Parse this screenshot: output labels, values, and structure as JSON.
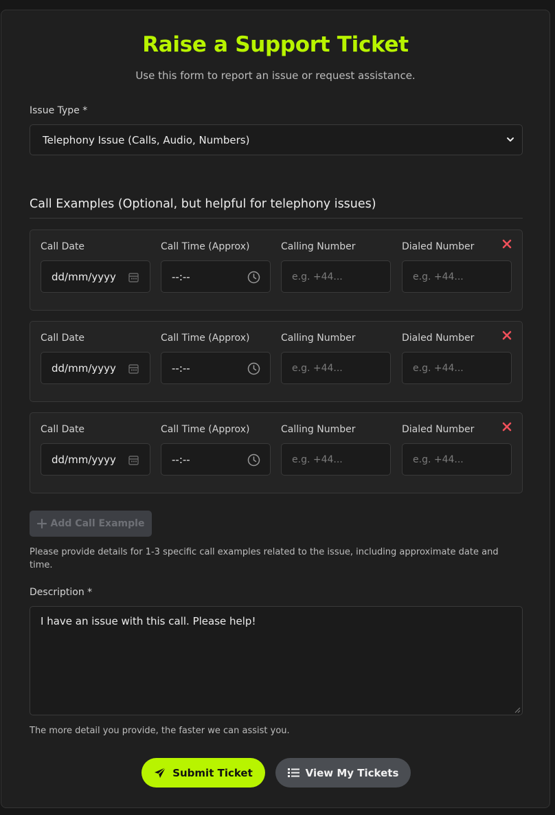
{
  "header": {
    "title": "Raise a Support Ticket",
    "subtitle": "Use this form to report an issue or request assistance."
  },
  "issue_type": {
    "label": "Issue Type *",
    "selected": "Telephony Issue (Calls, Audio, Numbers)"
  },
  "call_examples": {
    "title": "Call Examples (Optional, but helpful for telephony issues)",
    "labels": {
      "date": "Call Date",
      "time": "Call Time (Approx)",
      "calling": "Calling Number",
      "dialed": "Dialed Number"
    },
    "items": [
      {
        "date": "dd/mm/yyyy",
        "time": "--:--",
        "calling_placeholder": "e.g. +44...",
        "dialed_placeholder": "e.g. +44..."
      },
      {
        "date": "dd/mm/yyyy",
        "time": "--:--",
        "calling_placeholder": "e.g. +44...",
        "dialed_placeholder": "e.g. +44..."
      },
      {
        "date": "dd/mm/yyyy",
        "time": "--:--",
        "calling_placeholder": "e.g. +44...",
        "dialed_placeholder": "e.g. +44..."
      }
    ],
    "add_label": "Add Call Example",
    "help": "Please provide details for 1-3 specific call examples related to the issue, including approximate date and time."
  },
  "description": {
    "label": "Description *",
    "value": "I have an issue with this call. Please help!",
    "help": "The more detail you provide, the faster we can assist you."
  },
  "actions": {
    "submit": "Submit Ticket",
    "view": "View My Tickets"
  },
  "colors": {
    "accent": "#b8f400",
    "remove": "#f0505a",
    "background": "#1f1f1f"
  }
}
